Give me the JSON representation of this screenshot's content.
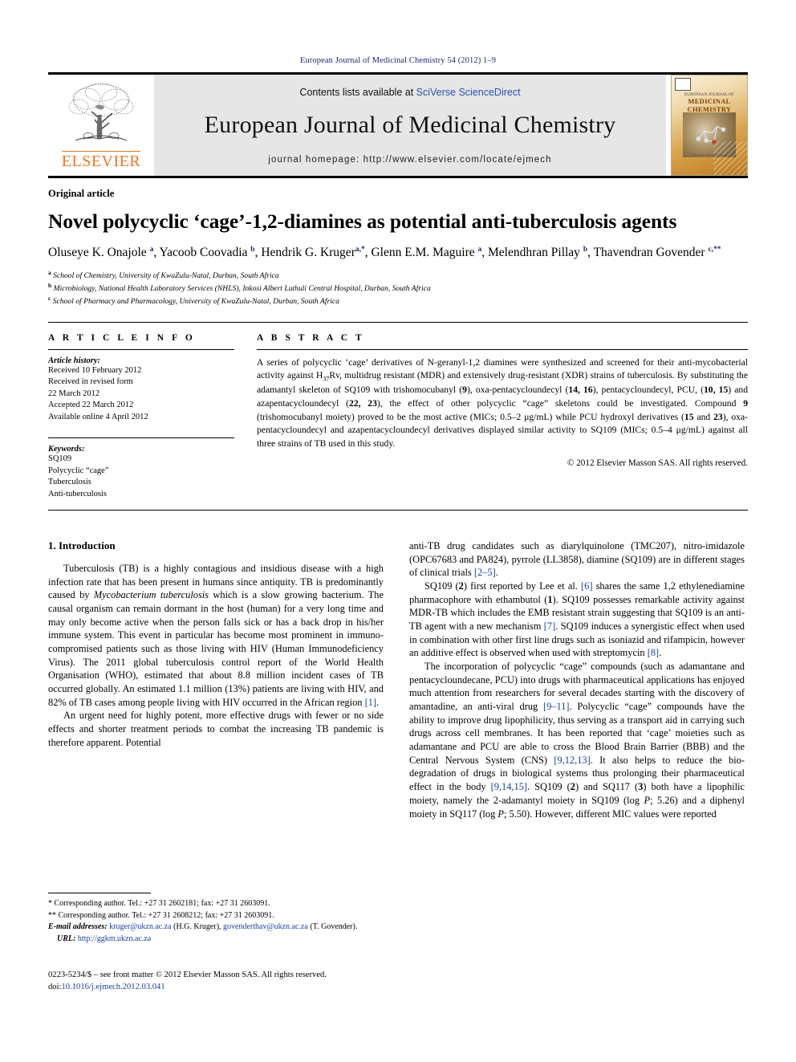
{
  "running_head": "European Journal of Medicinal Chemistry 54 (2012) 1–9",
  "masthead": {
    "publisher_name": "ELSEVIER",
    "contents_prefix": "Contents lists available at ",
    "contents_link": "SciVerse ScienceDirect",
    "journal_title": "European Journal of Medicinal Chemistry",
    "homepage": "journal homepage: http://www.elsevier.com/locate/ejmech",
    "cover": {
      "line1": "EUROPEAN JOURNAL OF",
      "line2": "MEDICINAL",
      "line3": "CHEMISTRY",
      "footer": "ISSN 0223-5234 VOLUME 54"
    }
  },
  "article": {
    "type": "Original article",
    "title": "Novel polycyclic ‘cage’-1,2-diamines as potential anti-tuberculosis agents",
    "authors_html": "Oluseye K. Onajole <sup>a</sup>, Yacoob Coovadia <sup>b</sup>, Hendrik G. Kruger<sup>a,*</sup>, Glenn E.M. Maguire <sup>a</sup>, Melendhran Pillay <sup>b</sup>, Thavendran Govender <sup>c,**</sup>",
    "affiliations": [
      {
        "marker": "a",
        "text": "School of Chemistry, University of KwaZulu-Natal, Durban, South Africa"
      },
      {
        "marker": "b",
        "text": "Microbiology, National Health Laboratory Services (NHLS), Inkosi Albert Luthuli Central Hospital, Durban, South Africa"
      },
      {
        "marker": "c",
        "text": "School of Pharmacy and Pharmacology, University of KwaZulu-Natal, Durban, South Africa"
      }
    ]
  },
  "article_info": {
    "heading": "A R T I C L E  I N F O",
    "history_title": "Article history:",
    "history": [
      "Received 10 February 2012",
      "Received in revised form",
      "22 March 2012",
      "Accepted 22 March 2012",
      "Available online 4 April 2012"
    ],
    "keywords_title": "Keywords:",
    "keywords": [
      "SQ109",
      "Polycyclic “cage”",
      "Tuberculosis",
      "Anti-tuberculosis"
    ]
  },
  "abstract": {
    "heading": "A B S T R A C T",
    "body_html": "A series of polycyclic ‘cage’ derivatives of N-geranyl-1,2 diamines were synthesized and screened for their anti-mycobacterial activity against H<sub>37</sub>Rv, multidrug resistant (MDR) and extensively drug-resistant (XDR) strains of tuberculosis. By substituting the adamantyl skeleton of SQ109 with trishomocubanyl (<b>9</b>), oxa-pentacycloundecyl (<b>14, 16</b>), pentacycloundecyl, PCU, (<b>10, 15</b>) and azapentacycloundecyl (<b>22, 23</b>), the effect of other polycyclic “cage” skeletons could be investigated. Compound <b>9</b> (trishomocubanyl moiety) proved to be the most active (MICs; 0.5–2 μg/mL) while PCU hydroxyl derivatives (<b>15</b> and <b>23</b>), oxa-pentacycloundecyl and azapentacycloundecyl derivatives displayed similar activity to SQ109 (MICs; 0.5–4 μg/mL) against all three strains of TB used in this study.",
    "copyright": "© 2012 Elsevier Masson SAS. All rights reserved."
  },
  "body": {
    "section_number_title": "1.  Introduction",
    "left_paragraphs_html": [
      "Tuberculosis (TB) is a highly contagious and insidious disease with a high infection rate that has been present in humans since antiquity. TB is predominantly caused by <i>Mycobacterium tuberculosis</i> which is a slow growing bacterium. The causal organism can remain dormant in the host (human) for a very long time and may only become active when the person falls sick or has a back drop in his/her immune system. This event in particular has become most prominent in immuno-compromised patients such as those living with HIV (Human Immunodeficiency Virus). The 2011 global tuberculosis control report of the World Health Organisation (WHO), estimated that about 8.8 million incident cases of TB occurred globally. An estimated 1.1 million (13%) patients are living with HIV, and 82% of TB cases among people living with HIV occurred in the African region <span class=\"cite\">[1]</span>.",
      "An urgent need for highly potent, more effective drugs with fewer or no side effects and shorter treatment periods to combat the increasing TB pandemic is therefore apparent. Potential"
    ],
    "right_paragraphs_html": [
      "anti-TB drug candidates such as diarylquinolone (TMC207), nitro-imidazole (OPC67683 and PA824), pyrrole (LL3858), diamine (SQ109) are in different stages of clinical trials <span class=\"cite\">[2–5]</span>.",
      "SQ109 (<b>2</b>) first reported by Lee et al. <span class=\"cite\">[6]</span> shares the same 1,2 ethylenediamine pharmacophore with ethambutol (<b>1</b>). SQ109 possesses remarkable activity against MDR-TB which includes the EMB resistant strain suggesting that SQ109 is an anti-TB agent with a new mechanism <span class=\"cite\">[7]</span>. SQ109 induces a synergistic effect when used in combination with other first line drugs such as isoniazid and rifampicin, however an additive effect is observed when used with streptomycin <span class=\"cite\">[8]</span>.",
      "The incorporation of polycyclic “cage” compounds (such as adamantane and pentacycloundecane, PCU) into drugs with pharmaceutical applications has enjoyed much attention from researchers for several decades starting with the discovery of amantadine, an anti-viral drug <span class=\"cite\">[9–11]</span>. Polycyclic “cage” compounds have the ability to improve drug lipophilicity, thus serving as a transport aid in carrying such drugs across cell membranes. It has been reported that ‘cage’ moieties such as adamantane and PCU are able to cross the Blood Brain Barrier (BBB) and the Central Nervous System (CNS) <span class=\"cite\">[9,12,13]</span>. It also helps to reduce the bio-degradation of drugs in biological systems thus prolonging their pharmaceutical effect in the body <span class=\"cite\">[9,14,15]</span>. SQ109 (<b>2</b>) and SQ117 (<b>3</b>) both have a lipophilic moiety, namely the 2-adamantyl moiety in SQ109 (log <i>P</i>; 5.26) and a diphenyl moiety in SQ117 (log <i>P</i>; 5.50). However, different MIC values were reported"
    ]
  },
  "footnotes": {
    "corresponding_1": "* Corresponding author. Tel.: +27 31 2602181; fax: +27 31 2603091.",
    "corresponding_2": "** Corresponding author. Tel.: +27 31 2608212; fax: +27 31 2603091.",
    "email_label": "E-mail addresses:",
    "email_1": "kruger@ukzn.ac.za",
    "email_1_name": "(H.G. Kruger),",
    "email_2": "govenderthav@ukzn.ac.za",
    "email_2_name": "(T. Govender).",
    "url_label": "URL:",
    "url_value": "http://ggkm.ukzn.ac.za"
  },
  "footer": {
    "issn_line": "0223-5234/$ – see front matter © 2012 Elsevier Masson SAS. All rights reserved.",
    "doi_label": "doi:",
    "doi_value": "10.1016/j.ejmech.2012.03.041"
  },
  "colors": {
    "link_blue": "#1a3fa0",
    "head_navy": "#1a2a6c",
    "elsevier_orange": "#E87722",
    "masthead_grey": "#e6e6e6"
  }
}
